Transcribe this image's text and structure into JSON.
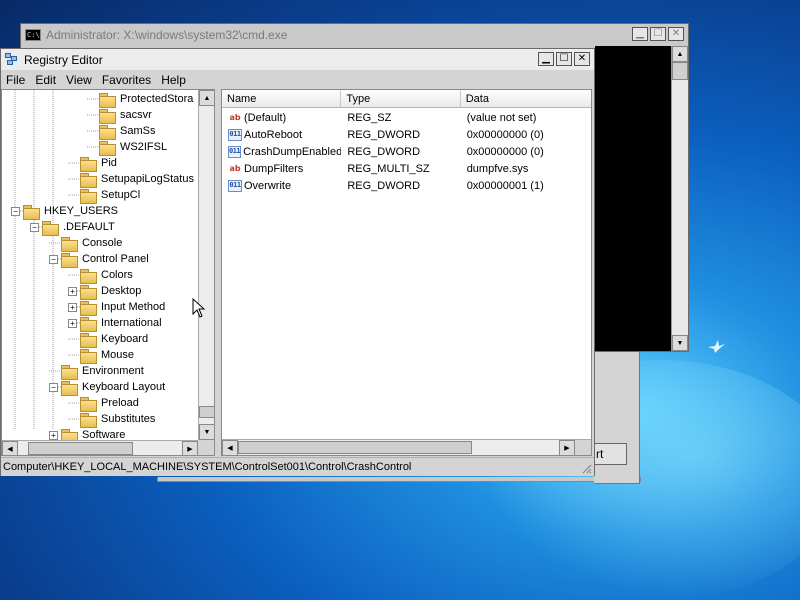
{
  "cmd_window": {
    "title": "Administrator: X:\\windows\\system32\\cmd.exe",
    "icon": "console-icon"
  },
  "regedit": {
    "title": "Registry Editor",
    "icon": "registry-editor-icon",
    "menu": [
      "File",
      "Edit",
      "View",
      "Favorites",
      "Help"
    ],
    "caption_buttons": [
      "minimize",
      "maximize",
      "close"
    ],
    "tree": [
      {
        "label": "ProtectedStora",
        "level": 4,
        "expander": ""
      },
      {
        "label": "sacsvr",
        "level": 4,
        "expander": ""
      },
      {
        "label": "SamSs",
        "level": 4,
        "expander": ""
      },
      {
        "label": "WS2IFSL",
        "level": 4,
        "expander": ""
      },
      {
        "label": "Pid",
        "level": 3,
        "expander": ""
      },
      {
        "label": "SetupapiLogStatus",
        "level": 3,
        "expander": ""
      },
      {
        "label": "SetupCl",
        "level": 3,
        "expander": ""
      },
      {
        "label": "HKEY_USERS",
        "level": 0,
        "expander": "minus"
      },
      {
        "label": ".DEFAULT",
        "level": 1,
        "expander": "minus"
      },
      {
        "label": "Console",
        "level": 2,
        "expander": ""
      },
      {
        "label": "Control Panel",
        "level": 2,
        "expander": "minus"
      },
      {
        "label": "Colors",
        "level": 3,
        "expander": ""
      },
      {
        "label": "Desktop",
        "level": 3,
        "expander": "plus"
      },
      {
        "label": "Input Method",
        "level": 3,
        "expander": "plus"
      },
      {
        "label": "International",
        "level": 3,
        "expander": "plus"
      },
      {
        "label": "Keyboard",
        "level": 3,
        "expander": ""
      },
      {
        "label": "Mouse",
        "level": 3,
        "expander": ""
      },
      {
        "label": "Environment",
        "level": 2,
        "expander": ""
      },
      {
        "label": "Keyboard Layout",
        "level": 2,
        "expander": "minus"
      },
      {
        "label": "Preload",
        "level": 3,
        "expander": ""
      },
      {
        "label": "Substitutes",
        "level": 3,
        "expander": ""
      },
      {
        "label": "Software",
        "level": 2,
        "expander": "plus"
      }
    ],
    "list": {
      "columns": [
        "Name",
        "Type",
        "Data"
      ],
      "rows": [
        {
          "name": "(Default)",
          "type": "REG_SZ",
          "data": "(value not set)",
          "icon": "string-value-icon"
        },
        {
          "name": "AutoReboot",
          "type": "REG_DWORD",
          "data": "0x00000000 (0)",
          "icon": "binary-value-icon"
        },
        {
          "name": "CrashDumpEnabled",
          "type": "REG_DWORD",
          "data": "0x00000000 (0)",
          "icon": "binary-value-icon"
        },
        {
          "name": "DumpFilters",
          "type": "REG_MULTI_SZ",
          "data": "dumpfve.sys",
          "icon": "string-value-icon"
        },
        {
          "name": "Overwrite",
          "type": "REG_DWORD",
          "data": "0x00000001 (1)",
          "icon": "binary-value-icon"
        }
      ]
    },
    "status": "Computer\\HKEY_LOCAL_MACHINE\\SYSTEM\\ControlSet001\\Control\\CrashControl"
  },
  "background_dialog": {
    "button_label_fragment": "rt"
  }
}
